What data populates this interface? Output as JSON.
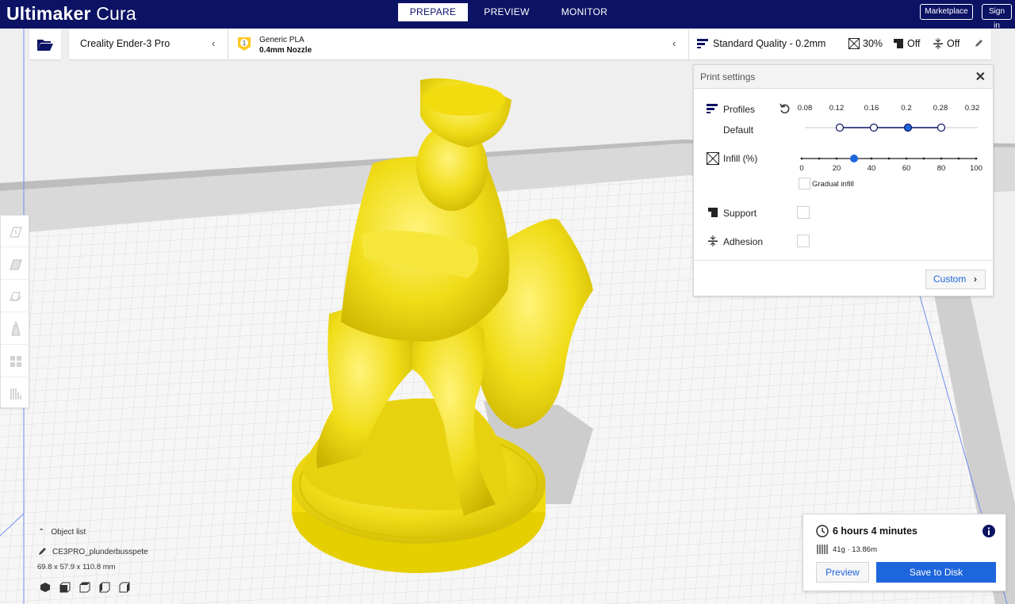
{
  "app": {
    "logo_bold": "Ultimaker",
    "logo_light": " Cura"
  },
  "stages": [
    {
      "label": "PREPARE",
      "active": true
    },
    {
      "label": "PREVIEW",
      "active": false
    },
    {
      "label": "MONITOR",
      "active": false
    }
  ],
  "topbar": {
    "marketplace": "Marketplace",
    "signin": "Sign in"
  },
  "machine": {
    "name": "Creality Ender-3 Pro"
  },
  "material": {
    "badge": "1",
    "name": "Generic PLA",
    "nozzle": "0.4mm Nozzle",
    "color": "#ffc924"
  },
  "quality": {
    "profile": "Standard Quality - 0.2mm",
    "infill": "30%",
    "support": "Off",
    "adhesion": "Off"
  },
  "print_settings": {
    "title": "Print settings",
    "profiles_label": "Profiles",
    "profile_value": "Default",
    "layer_heights": [
      "0.08",
      "0.12",
      "0.16",
      "0.2",
      "0.28",
      "0.32"
    ],
    "selected_layer_height": "0.2",
    "infill_label": "Infill (%)",
    "infill_ticks": [
      "0",
      "20",
      "40",
      "60",
      "80",
      "100"
    ],
    "infill_value": 30,
    "gradual_infill": "Gradual infill",
    "support_label": "Support",
    "adhesion_label": "Adhesion",
    "custom_button": "Custom"
  },
  "object_list": {
    "toggle_label": "Object list",
    "object_name": "CE3PRO_plunderbusspete",
    "dimensions": "69.8 x 57.9 x 110.8 mm"
  },
  "estimate": {
    "time": "6 hours 4 minutes",
    "material": "41g · 13.86m",
    "preview_button": "Preview",
    "save_button": "Save to Disk"
  },
  "colors": {
    "topbar": "#0c1364",
    "accent": "#1e66dc",
    "model": "#f4e020"
  }
}
